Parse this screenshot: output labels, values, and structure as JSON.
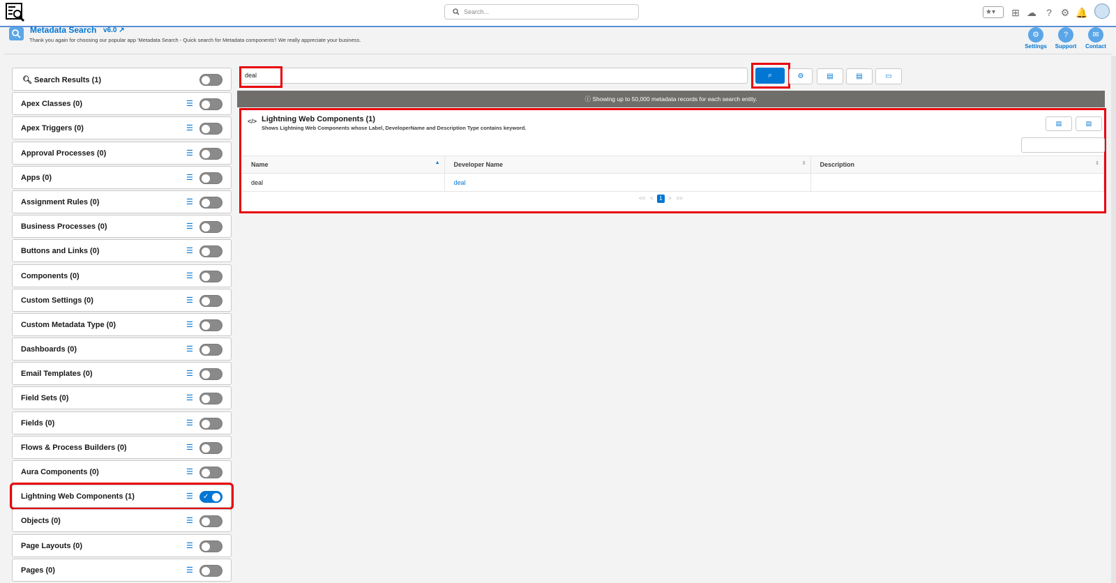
{
  "topbar": {
    "search_placeholder": "Search...",
    "icons": [
      "favorites-icon",
      "add-icon",
      "trailhead-icon",
      "help-icon",
      "setup-icon",
      "notifications-icon",
      "avatar"
    ]
  },
  "header": {
    "title": "Metadata Search",
    "version": "v6.0",
    "subtitle": "Thank you again for choosing our popular app 'Metadata Search - Quick search for Metadata components'! We really appreciate your business.",
    "settings_label": "Settings",
    "support_label": "Support",
    "contact_label": "Contact"
  },
  "sidebar": {
    "search_results": "Search Results (1)",
    "items": [
      {
        "label": "Apex Classes (0)",
        "on": false
      },
      {
        "label": "Apex Triggers (0)",
        "on": false
      },
      {
        "label": "Approval Processes (0)",
        "on": false
      },
      {
        "label": "Apps (0)",
        "on": false
      },
      {
        "label": "Assignment Rules (0)",
        "on": false
      },
      {
        "label": "Business Processes (0)",
        "on": false
      },
      {
        "label": "Buttons and Links (0)",
        "on": false
      },
      {
        "label": "Components (0)",
        "on": false
      },
      {
        "label": "Custom Settings (0)",
        "on": false
      },
      {
        "label": "Custom Metadata Type (0)",
        "on": false
      },
      {
        "label": "Dashboards (0)",
        "on": false
      },
      {
        "label": "Email Templates (0)",
        "on": false
      },
      {
        "label": "Field Sets (0)",
        "on": false
      },
      {
        "label": "Fields (0)",
        "on": false
      },
      {
        "label": "Flows & Process Builders (0)",
        "on": false
      },
      {
        "label": "Aura Components (0)",
        "on": false
      },
      {
        "label": "Lightning Web Components (1)",
        "on": true
      },
      {
        "label": "Objects (0)",
        "on": false
      },
      {
        "label": "Page Layouts (0)",
        "on": false
      },
      {
        "label": "Pages (0)",
        "on": false
      }
    ]
  },
  "main": {
    "search_value": "deal",
    "banner": "Showing up to 50,000 metadata records for each search entity.",
    "card": {
      "title": "Lightning Web Components (1)",
      "subtitle": "Shows Lightning Web Components whose Label, DeveloperName and Description Type contains keyword.",
      "columns": [
        "Name",
        "Developer Name",
        "Description"
      ],
      "rows": [
        {
          "name": "deal",
          "developer_name": "deal",
          "description": ""
        }
      ],
      "pager": {
        "first": "<<",
        "prev": "<",
        "current": "1",
        "next": ">",
        "last": ">>"
      }
    }
  },
  "colors": {
    "accent": "#0176d3",
    "highlight": "#e8000b",
    "toggle_off": "#8a8a8a"
  }
}
